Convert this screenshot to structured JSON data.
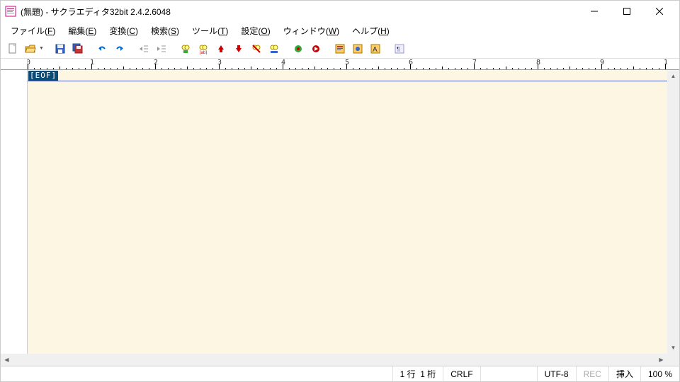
{
  "window": {
    "title": "(無題) - サクラエディタ32bit 2.4.2.6048"
  },
  "menu": {
    "items": [
      {
        "label": "ファイル",
        "accel": "F"
      },
      {
        "label": "編集",
        "accel": "E"
      },
      {
        "label": "変換",
        "accel": "C"
      },
      {
        "label": "検索",
        "accel": "S"
      },
      {
        "label": "ツール",
        "accel": "T"
      },
      {
        "label": "設定",
        "accel": "O"
      },
      {
        "label": "ウィンドウ",
        "accel": "W"
      },
      {
        "label": "ヘルプ",
        "accel": "H"
      }
    ]
  },
  "toolbar": {
    "groups": [
      [
        "new",
        "open",
        "open-dropdown"
      ],
      [
        "save",
        "save-all"
      ],
      [
        "undo",
        "redo"
      ],
      [
        "outdent",
        "indent"
      ],
      [
        "search",
        "search-regex",
        "bookmark-up",
        "bookmark-down",
        "bookmark-clear",
        "grep"
      ],
      [
        "record-macro",
        "play-macro"
      ],
      [
        "type-settings",
        "common-settings",
        "font-settings"
      ],
      [
        "show-all-chars"
      ]
    ]
  },
  "editor": {
    "eof_marker": "[EOF]",
    "background": "#fdf6e3"
  },
  "ruler": {
    "major_interval": 10,
    "range": 100
  },
  "status": {
    "line_label": "1 行",
    "col_label": "1 桁",
    "newline": "CRLF",
    "encoding": "UTF-8",
    "rec": "REC",
    "insert_mode": "挿入",
    "zoom": "100 %"
  }
}
